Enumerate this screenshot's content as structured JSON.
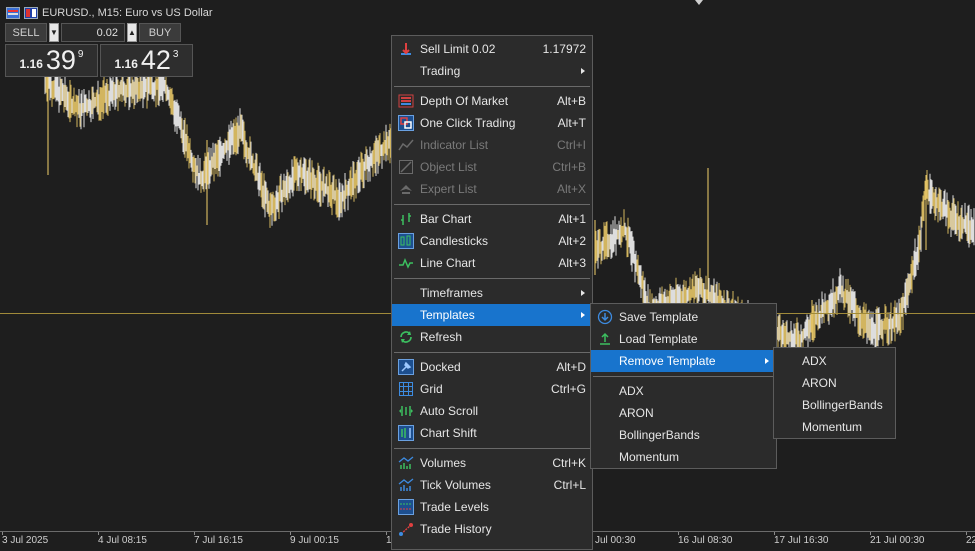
{
  "window": {
    "title": "EURUSD., M15:  Euro vs US Dollar"
  },
  "one_click": {
    "sell_label": "SELL",
    "buy_label": "BUY",
    "volume": "0.02",
    "sell_price_prefix": "1.16",
    "sell_price_big": "39",
    "sell_price_sup": "9",
    "buy_price_prefix": "1.16",
    "buy_price_big": "42",
    "buy_price_sup": "3"
  },
  "xaxis": {
    "labels": [
      "3 Jul 2025",
      "4 Jul 08:15",
      "7 Jul 16:15",
      "9 Jul 00:15",
      "1",
      "Jul 00:30",
      "16 Jul 08:30",
      "17 Jul 16:30",
      "21 Jul 00:30",
      "22"
    ]
  },
  "context_menu": {
    "items": [
      {
        "label": "Sell Limit 0.02",
        "shortcut": "1.17972",
        "icon": "sell-limit-icon"
      },
      {
        "label": "Trading",
        "submenu": true
      },
      {
        "sep": true
      },
      {
        "label": "Depth Of Market",
        "shortcut": "Alt+B",
        "icon": "depth-of-market-icon"
      },
      {
        "label": "One Click Trading",
        "shortcut": "Alt+T",
        "icon": "one-click-trading-icon"
      },
      {
        "label": "Indicator List",
        "shortcut": "Ctrl+I",
        "icon": "indicator-list-icon",
        "disabled": true
      },
      {
        "label": "Object List",
        "shortcut": "Ctrl+B",
        "icon": "object-list-icon",
        "disabled": true
      },
      {
        "label": "Expert List",
        "shortcut": "Alt+X",
        "icon": "expert-list-icon",
        "disabled": true
      },
      {
        "sep": true
      },
      {
        "label": "Bar Chart",
        "shortcut": "Alt+1",
        "icon": "bar-chart-icon"
      },
      {
        "label": "Candlesticks",
        "shortcut": "Alt+2",
        "icon": "candlesticks-icon"
      },
      {
        "label": "Line Chart",
        "shortcut": "Alt+3",
        "icon": "line-chart-icon"
      },
      {
        "sep": true
      },
      {
        "label": "Timeframes",
        "submenu": true
      },
      {
        "label": "Templates",
        "submenu": true,
        "highlighted": true
      },
      {
        "label": "Refresh",
        "icon": "refresh-icon"
      },
      {
        "sep": true
      },
      {
        "label": "Docked",
        "shortcut": "Alt+D",
        "icon": "docked-icon"
      },
      {
        "label": "Grid",
        "shortcut": "Ctrl+G",
        "icon": "grid-icon"
      },
      {
        "label": "Auto Scroll",
        "icon": "auto-scroll-icon"
      },
      {
        "label": "Chart Shift",
        "icon": "chart-shift-icon"
      },
      {
        "sep": true
      },
      {
        "label": "Volumes",
        "shortcut": "Ctrl+K",
        "icon": "volumes-icon"
      },
      {
        "label": "Tick Volumes",
        "shortcut": "Ctrl+L",
        "icon": "tick-volumes-icon"
      },
      {
        "label": "Trade Levels",
        "icon": "trade-levels-icon"
      },
      {
        "label": "Trade History",
        "icon": "trade-history-icon"
      }
    ]
  },
  "templates_menu": {
    "items": [
      {
        "label": "Save Template",
        "icon": "save-template-icon"
      },
      {
        "label": "Load Template",
        "icon": "load-template-icon"
      },
      {
        "label": "Remove Template",
        "submenu": true,
        "highlighted": true
      },
      {
        "sep": true
      },
      {
        "label": "ADX"
      },
      {
        "label": "ARON"
      },
      {
        "label": "BollingerBands"
      },
      {
        "label": "Momentum"
      }
    ]
  },
  "remove_template_menu": {
    "items": [
      {
        "label": "ADX"
      },
      {
        "label": "ARON"
      },
      {
        "label": "BollingerBands"
      },
      {
        "label": "Momentum"
      }
    ]
  },
  "colors": {
    "accent": "#1874cd",
    "price_line": "#f2d06b",
    "level_line": "#a08a3a"
  }
}
